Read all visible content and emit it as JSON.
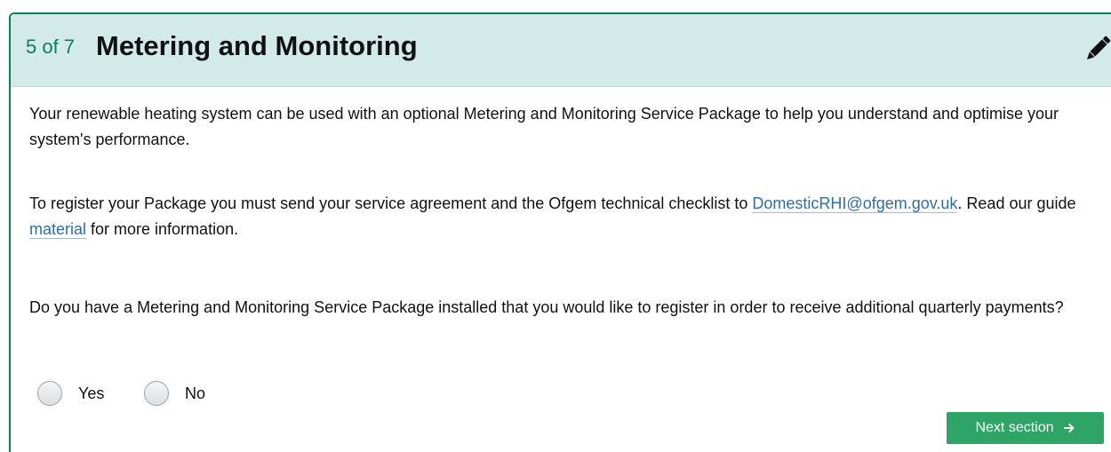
{
  "section": {
    "step": "5 of 7",
    "title": "Metering and Monitoring",
    "edit_icon": "pencil-icon"
  },
  "content": {
    "intro": "Your renewable heating system can be used with an optional Metering and Monitoring Service Package to help you understand and optimise your system's performance.",
    "register_prefix": "To register your Package you must send your service agreement and the Ofgem technical checklist to ",
    "email_link": "DomesticRHI@ofgem.gov.uk",
    "register_middle": ". Read our guide ",
    "guide_link": "material",
    "register_suffix": " for more information.",
    "question": "Do you have a Metering and Monitoring Service Package installed that you would like to register in order to receive additional quarterly payments?"
  },
  "radio": {
    "options": [
      {
        "label": "Yes",
        "selected": false
      },
      {
        "label": "No",
        "selected": false
      }
    ]
  },
  "actions": {
    "next_label": "Next section",
    "next_icon": "arrow-right-icon"
  },
  "colors": {
    "accent": "#0f7d5c",
    "header_bg": "#d3ebe8",
    "link": "#2f6ea5",
    "button": "#2ea566"
  }
}
